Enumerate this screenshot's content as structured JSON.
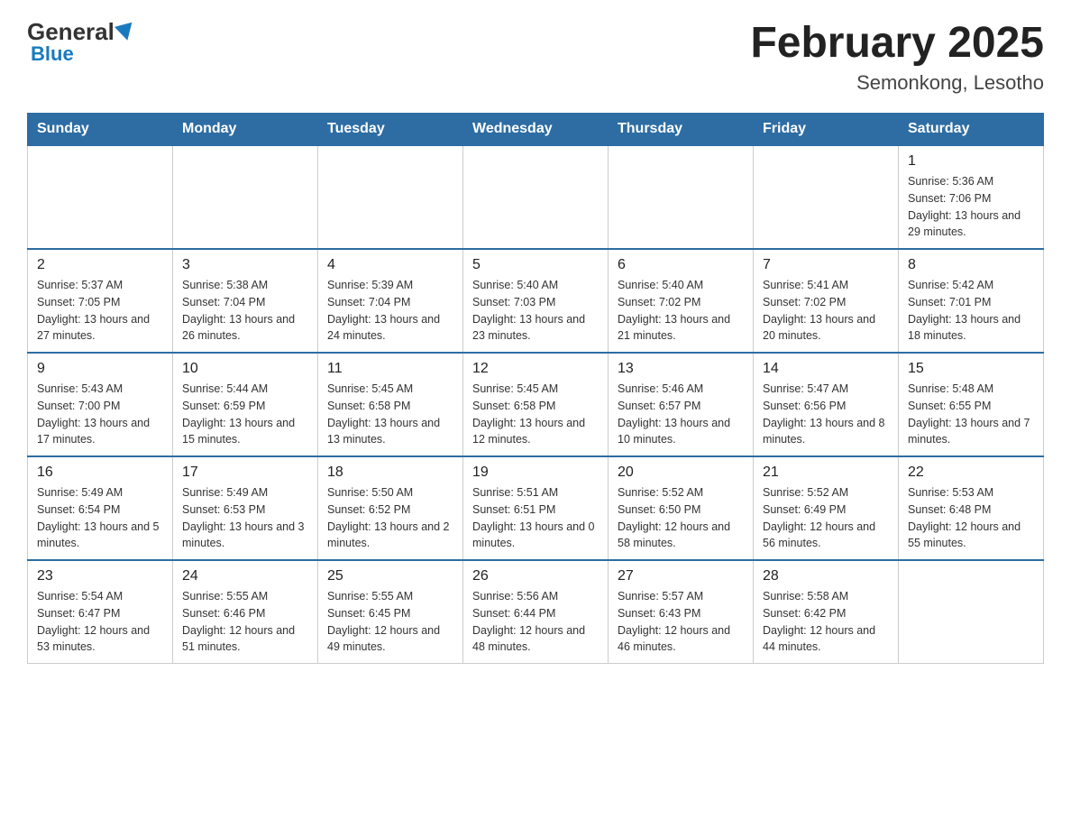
{
  "header": {
    "logo": {
      "general": "General",
      "blue": "Blue"
    },
    "title": "February 2025",
    "subtitle": "Semonkong, Lesotho"
  },
  "weekdays": [
    "Sunday",
    "Monday",
    "Tuesday",
    "Wednesday",
    "Thursday",
    "Friday",
    "Saturday"
  ],
  "weeks": [
    [
      {
        "day": "",
        "info": ""
      },
      {
        "day": "",
        "info": ""
      },
      {
        "day": "",
        "info": ""
      },
      {
        "day": "",
        "info": ""
      },
      {
        "day": "",
        "info": ""
      },
      {
        "day": "",
        "info": ""
      },
      {
        "day": "1",
        "info": "Sunrise: 5:36 AM\nSunset: 7:06 PM\nDaylight: 13 hours and 29 minutes."
      }
    ],
    [
      {
        "day": "2",
        "info": "Sunrise: 5:37 AM\nSunset: 7:05 PM\nDaylight: 13 hours and 27 minutes."
      },
      {
        "day": "3",
        "info": "Sunrise: 5:38 AM\nSunset: 7:04 PM\nDaylight: 13 hours and 26 minutes."
      },
      {
        "day": "4",
        "info": "Sunrise: 5:39 AM\nSunset: 7:04 PM\nDaylight: 13 hours and 24 minutes."
      },
      {
        "day": "5",
        "info": "Sunrise: 5:40 AM\nSunset: 7:03 PM\nDaylight: 13 hours and 23 minutes."
      },
      {
        "day": "6",
        "info": "Sunrise: 5:40 AM\nSunset: 7:02 PM\nDaylight: 13 hours and 21 minutes."
      },
      {
        "day": "7",
        "info": "Sunrise: 5:41 AM\nSunset: 7:02 PM\nDaylight: 13 hours and 20 minutes."
      },
      {
        "day": "8",
        "info": "Sunrise: 5:42 AM\nSunset: 7:01 PM\nDaylight: 13 hours and 18 minutes."
      }
    ],
    [
      {
        "day": "9",
        "info": "Sunrise: 5:43 AM\nSunset: 7:00 PM\nDaylight: 13 hours and 17 minutes."
      },
      {
        "day": "10",
        "info": "Sunrise: 5:44 AM\nSunset: 6:59 PM\nDaylight: 13 hours and 15 minutes."
      },
      {
        "day": "11",
        "info": "Sunrise: 5:45 AM\nSunset: 6:58 PM\nDaylight: 13 hours and 13 minutes."
      },
      {
        "day": "12",
        "info": "Sunrise: 5:45 AM\nSunset: 6:58 PM\nDaylight: 13 hours and 12 minutes."
      },
      {
        "day": "13",
        "info": "Sunrise: 5:46 AM\nSunset: 6:57 PM\nDaylight: 13 hours and 10 minutes."
      },
      {
        "day": "14",
        "info": "Sunrise: 5:47 AM\nSunset: 6:56 PM\nDaylight: 13 hours and 8 minutes."
      },
      {
        "day": "15",
        "info": "Sunrise: 5:48 AM\nSunset: 6:55 PM\nDaylight: 13 hours and 7 minutes."
      }
    ],
    [
      {
        "day": "16",
        "info": "Sunrise: 5:49 AM\nSunset: 6:54 PM\nDaylight: 13 hours and 5 minutes."
      },
      {
        "day": "17",
        "info": "Sunrise: 5:49 AM\nSunset: 6:53 PM\nDaylight: 13 hours and 3 minutes."
      },
      {
        "day": "18",
        "info": "Sunrise: 5:50 AM\nSunset: 6:52 PM\nDaylight: 13 hours and 2 minutes."
      },
      {
        "day": "19",
        "info": "Sunrise: 5:51 AM\nSunset: 6:51 PM\nDaylight: 13 hours and 0 minutes."
      },
      {
        "day": "20",
        "info": "Sunrise: 5:52 AM\nSunset: 6:50 PM\nDaylight: 12 hours and 58 minutes."
      },
      {
        "day": "21",
        "info": "Sunrise: 5:52 AM\nSunset: 6:49 PM\nDaylight: 12 hours and 56 minutes."
      },
      {
        "day": "22",
        "info": "Sunrise: 5:53 AM\nSunset: 6:48 PM\nDaylight: 12 hours and 55 minutes."
      }
    ],
    [
      {
        "day": "23",
        "info": "Sunrise: 5:54 AM\nSunset: 6:47 PM\nDaylight: 12 hours and 53 minutes."
      },
      {
        "day": "24",
        "info": "Sunrise: 5:55 AM\nSunset: 6:46 PM\nDaylight: 12 hours and 51 minutes."
      },
      {
        "day": "25",
        "info": "Sunrise: 5:55 AM\nSunset: 6:45 PM\nDaylight: 12 hours and 49 minutes."
      },
      {
        "day": "26",
        "info": "Sunrise: 5:56 AM\nSunset: 6:44 PM\nDaylight: 12 hours and 48 minutes."
      },
      {
        "day": "27",
        "info": "Sunrise: 5:57 AM\nSunset: 6:43 PM\nDaylight: 12 hours and 46 minutes."
      },
      {
        "day": "28",
        "info": "Sunrise: 5:58 AM\nSunset: 6:42 PM\nDaylight: 12 hours and 44 minutes."
      },
      {
        "day": "",
        "info": ""
      }
    ]
  ]
}
